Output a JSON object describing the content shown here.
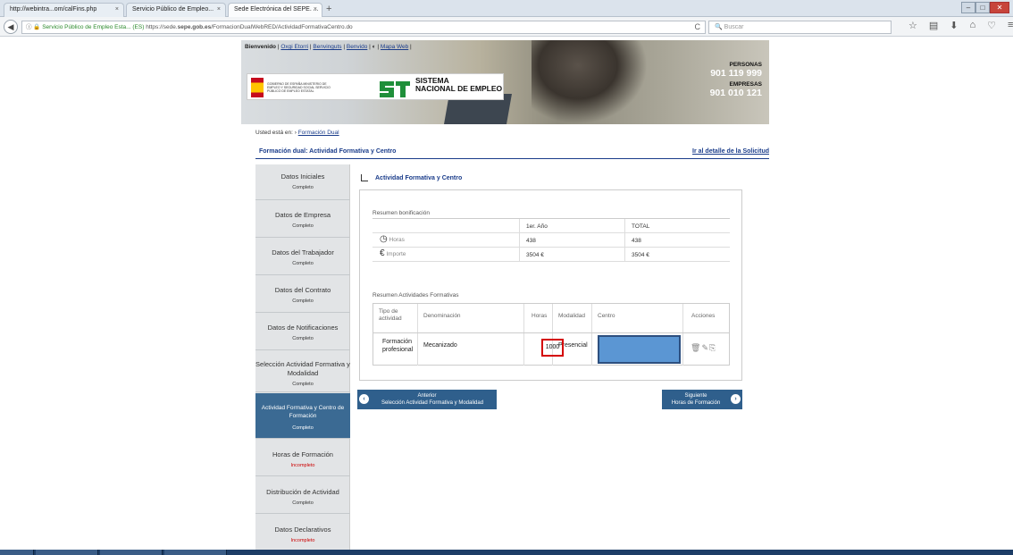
{
  "browser": {
    "tabs": [
      {
        "label": "http://webintra...om/calFins.php",
        "close": "×"
      },
      {
        "label": "Servicio Público de Empleo...",
        "close": "×"
      },
      {
        "label": "Sede Electrónica del SEPE. ...",
        "close": "×"
      }
    ],
    "new_tab": "+",
    "address_prefix": "Servicio Público de Empleo Esta... (ES)",
    "address_url_pre": "https://sede.",
    "address_url_bold": "sepe.gob.es",
    "address_url_post": "/FormacionDualWebRED/ActividadFormativaCentro.do",
    "reload": "C",
    "search_placeholder": "Buscar"
  },
  "banner": {
    "welcome": "Bienvenido",
    "user": "Oxgi Etorri",
    "langs": [
      "Benvinguts",
      "Benvido"
    ],
    "map": "Mapa Web",
    "gov_text": "GOBIERNO DE ESPAÑA   MINISTERIO DE EMPLEO Y SEGURIDAD SOCIAL   SERVICIO PÚBLICO DE EMPLEO ESTATAL",
    "sne_line1": "SISTEMA",
    "sne_line2": "NACIONAL DE EMPLEO",
    "personas_label": "PERSONAS",
    "personas_phone": "901 119 999",
    "empresas_label": "EMPRESAS",
    "empresas_phone": "901 010 121"
  },
  "breadcrumb": {
    "prefix": "Usted está en:",
    "link": "Formación Dual"
  },
  "section": {
    "title": "Formación dual: Actividad Formativa y Centro",
    "detail_link": "Ir al detalle de la Solicitud"
  },
  "sidebar": {
    "items": [
      {
        "name": "Datos Iniciales",
        "status": "Completo"
      },
      {
        "name": "Datos de Empresa",
        "status": "Completo"
      },
      {
        "name": "Datos del Trabajador",
        "status": "Completo"
      },
      {
        "name": "Datos del Contrato",
        "status": "Completo"
      },
      {
        "name": "Datos de Notificaciones",
        "status": "Completo"
      },
      {
        "name": "Selección Actividad Formativa y Modalidad",
        "status": "Completo"
      },
      {
        "name": "Actividad Formativa y Centro de Formación",
        "status": "Completo"
      },
      {
        "name": "Horas de Formación",
        "status": "Incompleto"
      },
      {
        "name": "Distribución de Actividad",
        "status": "Completo"
      },
      {
        "name": "Datos Declarativos",
        "status": "Incompleto"
      }
    ]
  },
  "main": {
    "title": "Actividad Formativa y Centro",
    "resumen_bonificacion": "Resumen bonificación",
    "sum_headers": [
      "",
      "1er. Año",
      "TOTAL"
    ],
    "sum_rows": [
      {
        "label": "Horas",
        "y1": "438",
        "total": "438"
      },
      {
        "label": "Importe",
        "y1": "3504 €",
        "total": "3504 €"
      }
    ],
    "resumen_actividades": "Resumen Actividades Formativas",
    "act_headers": [
      "Tipo de actividad",
      "Denominación",
      "Horas",
      "Modalidad",
      "Centro",
      "Acciones"
    ],
    "act_row": {
      "tipo": "Formación profesional",
      "denominacion": "Mecanizado",
      "horas": "1000",
      "modalidad": "Presencial",
      "centro": ""
    },
    "prev_label": "Anterior",
    "prev_sub": "Selección Actividad Formativa y Modalidad",
    "next_label": "Siguiente",
    "next_sub": "Horas de Formación"
  },
  "colors": {
    "accent": "#1a3c8a",
    "sidebar_active": "#3b6a93",
    "button": "#2f5f8c",
    "highlight_red": "#d40000",
    "centro_fill": "#5b96d3"
  }
}
